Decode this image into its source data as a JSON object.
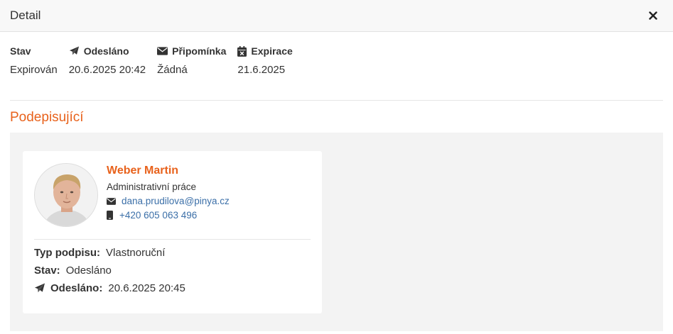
{
  "header": {
    "title": "Detail"
  },
  "info": {
    "status": {
      "label": "Stav",
      "value": "Expirován"
    },
    "sent": {
      "label": "Odesláno",
      "value": "20.6.2025 20:42",
      "icon": "paper-plane-icon"
    },
    "reminder": {
      "label": "Připomínka",
      "value": "Žádná",
      "icon": "envelope-icon"
    },
    "expiration": {
      "label": "Expirace",
      "value": "21.6.2025",
      "icon": "calendar-x-icon"
    }
  },
  "section": {
    "title": "Podepisující"
  },
  "signer": {
    "name": "Weber Martin",
    "role": "Administrativní práce",
    "email": "dana.prudilova@pinya.cz",
    "phone": "+420 605 063 496",
    "signature_type_label": "Typ podpisu:",
    "signature_type": "Vlastnoruční",
    "status_label": "Stav:",
    "status": "Odesláno",
    "sent_label": "Odesláno:",
    "sent": "20.6.2025 20:45"
  },
  "colors": {
    "accent": "#e8621c",
    "link": "#3b6fa8",
    "panel": "#f3f3f3"
  }
}
